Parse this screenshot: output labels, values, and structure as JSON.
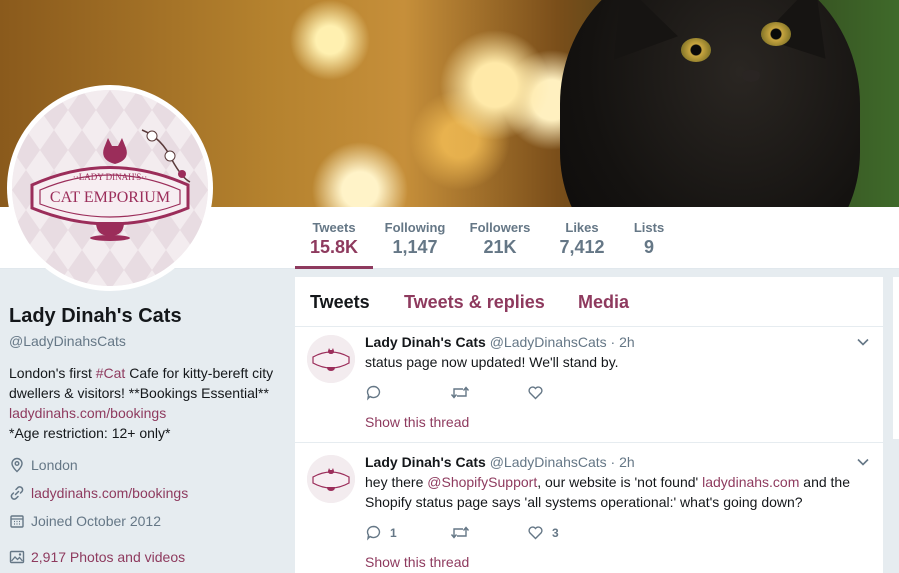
{
  "profile": {
    "name": "Lady Dinah's Cats",
    "handle": "@LadyDinahsCats",
    "bio_prefix": "London's first ",
    "bio_hashtag": "#Cat",
    "bio_mid": " Cafe for kitty-bereft city dwellers & visitors! **Bookings Essential** ",
    "bio_link": "ladydinahs.com/bookings",
    "bio_suffix": "*Age restriction: 12+ only*",
    "location": "London",
    "website": "ladydinahs.com/bookings",
    "joined": "Joined October 2012",
    "photos": "2,917 Photos and videos",
    "logo_line1": "LADY DINAH'S",
    "logo_line2": "CAT EMPORIUM"
  },
  "stats": [
    {
      "label": "Tweets",
      "value": "15.8K"
    },
    {
      "label": "Following",
      "value": "1,147"
    },
    {
      "label": "Followers",
      "value": "21K"
    },
    {
      "label": "Likes",
      "value": "7,412"
    },
    {
      "label": "Lists",
      "value": "9"
    }
  ],
  "tabs": [
    "Tweets",
    "Tweets & replies",
    "Media"
  ],
  "tweets": [
    {
      "name": "Lady Dinah's Cats",
      "handle": "@LadyDinahsCats",
      "sep": "·",
      "time": "2h",
      "text": "status page now updated! We'll stand by.",
      "reply_count": "",
      "retweet_count": "",
      "like_count": "",
      "thread": "Show this thread"
    },
    {
      "name": "Lady Dinah's Cats",
      "handle": "@LadyDinahsCats",
      "sep": "·",
      "time": "2h",
      "text_1": "hey there ",
      "mention": "@ShopifySupport",
      "text_2": ", our website is 'not found' ",
      "link": "ladydinahs.com",
      "text_3": " and the Shopify status page says 'all systems operational:' what's going down?",
      "reply_count": "1",
      "retweet_count": "",
      "like_count": "3",
      "thread": "Show this thread"
    }
  ],
  "colors": {
    "accent": "#8e3a5e",
    "muted": "#657786",
    "background": "#e6ecf0"
  }
}
